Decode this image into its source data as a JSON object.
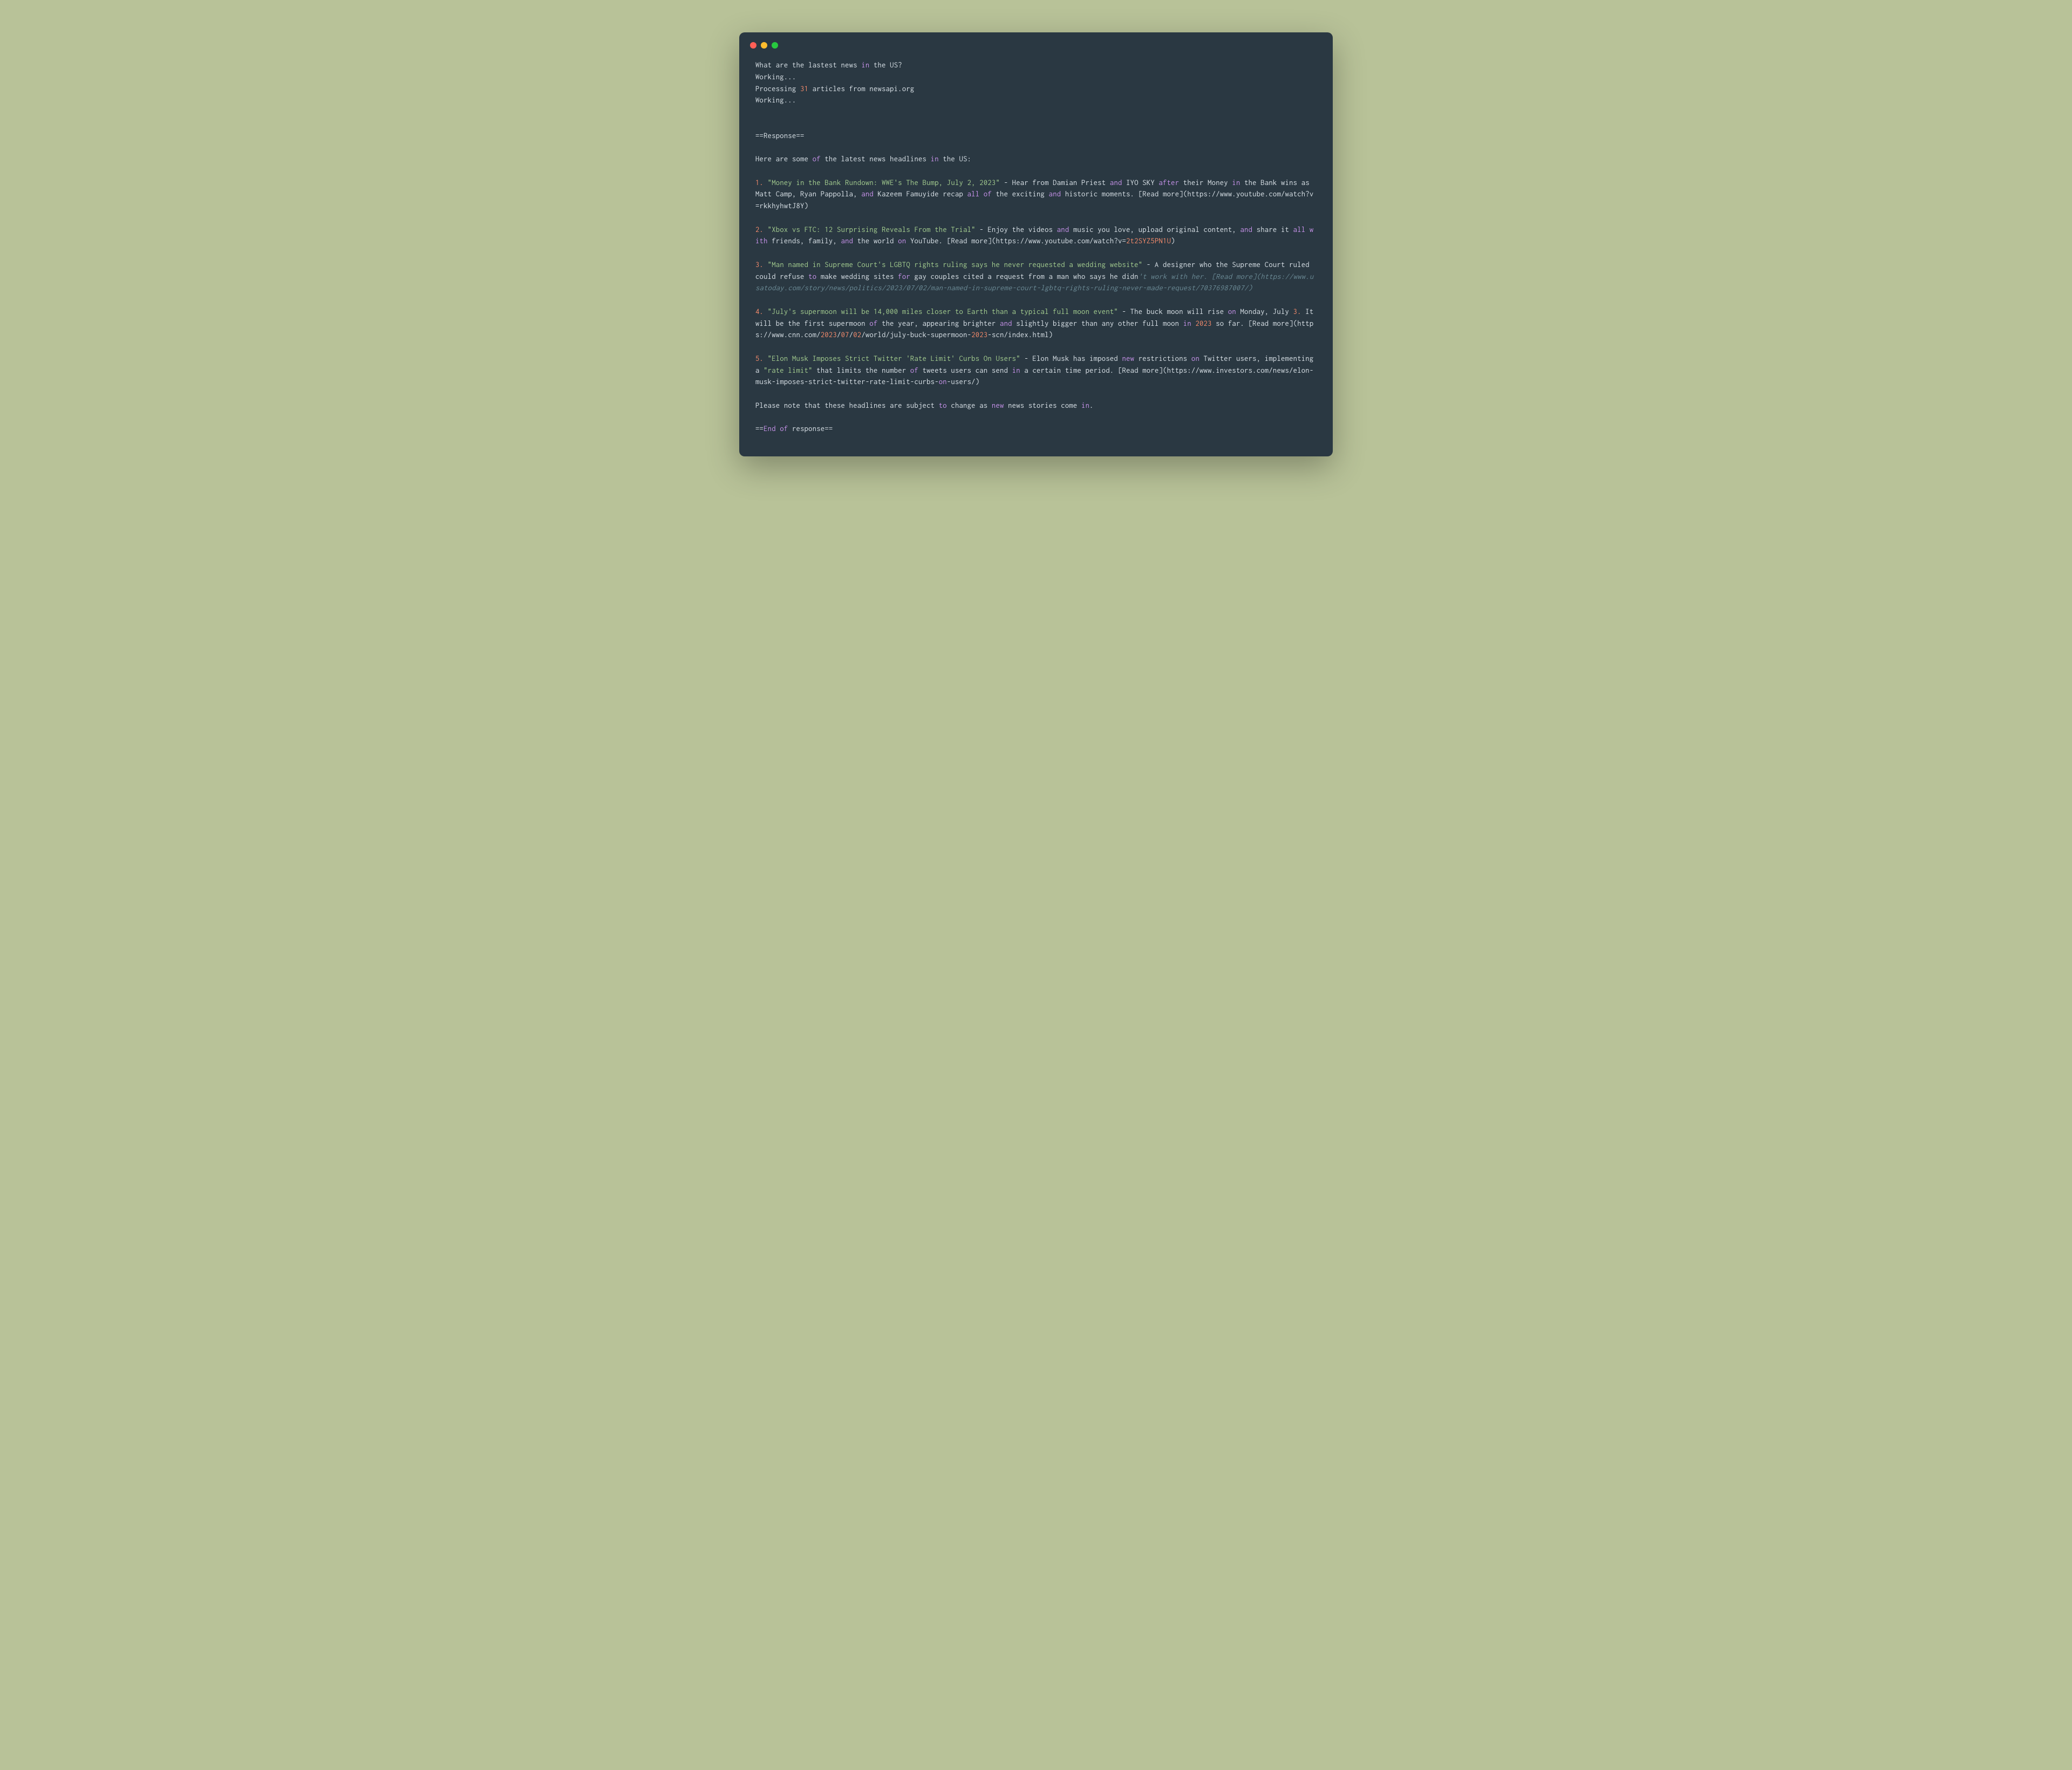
{
  "title_bar": {
    "buttons": [
      "close",
      "minimize",
      "maximize"
    ]
  },
  "lines": [
    [
      {
        "text": "What are the lastest news ",
        "cls": "default"
      },
      {
        "text": "in",
        "cls": "keyword"
      },
      {
        "text": " the US?",
        "cls": "default"
      }
    ],
    [
      {
        "text": "Working...",
        "cls": "default"
      }
    ],
    [
      {
        "text": "Processing ",
        "cls": "default"
      },
      {
        "text": "31",
        "cls": "number"
      },
      {
        "text": " articles from newsapi.org",
        "cls": "default"
      }
    ],
    [
      {
        "text": "Working...",
        "cls": "default"
      }
    ],
    [],
    [],
    [
      {
        "text": "==Response==",
        "cls": "default"
      }
    ],
    [],
    [
      {
        "text": "Here are some ",
        "cls": "default"
      },
      {
        "text": "of",
        "cls": "keyword"
      },
      {
        "text": " the latest news headlines ",
        "cls": "default"
      },
      {
        "text": "in",
        "cls": "keyword"
      },
      {
        "text": " the US:",
        "cls": "default"
      }
    ],
    [],
    [
      {
        "text": "1.",
        "cls": "number"
      },
      {
        "text": " ",
        "cls": "default"
      },
      {
        "text": "\"Money in the Bank Rundown: WWE's The Bump, July 2, 2023\"",
        "cls": "string"
      },
      {
        "text": " - Hear from Damian Priest ",
        "cls": "default"
      },
      {
        "text": "and",
        "cls": "keyword"
      },
      {
        "text": " IYO SKY ",
        "cls": "default"
      },
      {
        "text": "after",
        "cls": "keyword"
      },
      {
        "text": " their Money ",
        "cls": "default"
      },
      {
        "text": "in",
        "cls": "keyword"
      },
      {
        "text": " the Bank wins as Matt Camp, Ryan Pappolla, ",
        "cls": "default"
      },
      {
        "text": "and",
        "cls": "keyword"
      },
      {
        "text": " Kazeem Famuyide recap ",
        "cls": "default"
      },
      {
        "text": "all",
        "cls": "keyword"
      },
      {
        "text": " ",
        "cls": "default"
      },
      {
        "text": "of",
        "cls": "keyword"
      },
      {
        "text": " the exciting ",
        "cls": "default"
      },
      {
        "text": "and",
        "cls": "keyword"
      },
      {
        "text": " historic moments. [Read more](https://www.youtube.com/watch?v=rkkhyhwtJ8Y)",
        "cls": "default"
      }
    ],
    [],
    [
      {
        "text": "2.",
        "cls": "number"
      },
      {
        "text": " ",
        "cls": "default"
      },
      {
        "text": "\"Xbox vs FTC: 12 Surprising Reveals From the Trial\"",
        "cls": "string"
      },
      {
        "text": " - Enjoy the videos ",
        "cls": "default"
      },
      {
        "text": "and",
        "cls": "keyword"
      },
      {
        "text": " music you love, upload original content, ",
        "cls": "default"
      },
      {
        "text": "and",
        "cls": "keyword"
      },
      {
        "text": " share it ",
        "cls": "default"
      },
      {
        "text": "all",
        "cls": "keyword"
      },
      {
        "text": " ",
        "cls": "default"
      },
      {
        "text": "with",
        "cls": "keyword"
      },
      {
        "text": " friends, family, ",
        "cls": "default"
      },
      {
        "text": "and",
        "cls": "keyword"
      },
      {
        "text": " the world ",
        "cls": "default"
      },
      {
        "text": "on",
        "cls": "keyword"
      },
      {
        "text": " YouTube. [Read more](https://www.youtube.com/watch?v=",
        "cls": "default"
      },
      {
        "text": "2t2SYZ5PN1U",
        "cls": "number"
      },
      {
        "text": ")",
        "cls": "default"
      }
    ],
    [],
    [
      {
        "text": "3.",
        "cls": "number"
      },
      {
        "text": " ",
        "cls": "default"
      },
      {
        "text": "\"Man named in Supreme Court's LGBTQ rights ruling says he never requested a wedding website\"",
        "cls": "string"
      },
      {
        "text": " - A designer who the Supreme Court ruled could refuse ",
        "cls": "default"
      },
      {
        "text": "to",
        "cls": "keyword"
      },
      {
        "text": " make wedding sites ",
        "cls": "default"
      },
      {
        "text": "for",
        "cls": "keyword"
      },
      {
        "text": " gay couples cited a request from a man who says he didn",
        "cls": "default"
      },
      {
        "text": "'t work with her. [Read more](https://www.usatoday.com/story/news/politics/2023/07/02/man-named-in-supreme-court-lgbtq-rights-ruling-never-made-request/70376987007/)",
        "cls": "comment"
      }
    ],
    [],
    [
      {
        "text": "4.",
        "cls": "number"
      },
      {
        "text": " ",
        "cls": "default"
      },
      {
        "text": "\"July's supermoon will be 14,000 miles closer to Earth than a typical full moon event\"",
        "cls": "string"
      },
      {
        "text": " - The buck moon will rise ",
        "cls": "default"
      },
      {
        "text": "on",
        "cls": "keyword"
      },
      {
        "text": " Monday, July ",
        "cls": "default"
      },
      {
        "text": "3.",
        "cls": "number"
      },
      {
        "text": " It will be the first supermoon ",
        "cls": "default"
      },
      {
        "text": "of",
        "cls": "keyword"
      },
      {
        "text": " the year, appearing brighter ",
        "cls": "default"
      },
      {
        "text": "and",
        "cls": "keyword"
      },
      {
        "text": " slightly bigger than any other full moon ",
        "cls": "default"
      },
      {
        "text": "in",
        "cls": "keyword"
      },
      {
        "text": " ",
        "cls": "default"
      },
      {
        "text": "2023",
        "cls": "number"
      },
      {
        "text": " so far. [Read more](https://www.cnn.com/",
        "cls": "default"
      },
      {
        "text": "2023",
        "cls": "number"
      },
      {
        "text": "/",
        "cls": "default"
      },
      {
        "text": "07",
        "cls": "number"
      },
      {
        "text": "/",
        "cls": "default"
      },
      {
        "text": "02",
        "cls": "number"
      },
      {
        "text": "/world/july-buck-supermoon-",
        "cls": "default"
      },
      {
        "text": "2023",
        "cls": "number"
      },
      {
        "text": "-scn/index.html)",
        "cls": "default"
      }
    ],
    [],
    [
      {
        "text": "5.",
        "cls": "number"
      },
      {
        "text": " ",
        "cls": "default"
      },
      {
        "text": "\"Elon Musk Imposes Strict Twitter 'Rate Limit' Curbs On Users\"",
        "cls": "string"
      },
      {
        "text": " - Elon Musk has imposed ",
        "cls": "default"
      },
      {
        "text": "new",
        "cls": "keyword"
      },
      {
        "text": " restrictions ",
        "cls": "default"
      },
      {
        "text": "on",
        "cls": "keyword"
      },
      {
        "text": " Twitter users, implementing a ",
        "cls": "default"
      },
      {
        "text": "\"rate limit\"",
        "cls": "string"
      },
      {
        "text": " that limits the number ",
        "cls": "default"
      },
      {
        "text": "of",
        "cls": "keyword"
      },
      {
        "text": " tweets users can send ",
        "cls": "default"
      },
      {
        "text": "in",
        "cls": "keyword"
      },
      {
        "text": " a certain time period. [Read more](https://www.investors.com/news/elon-musk-imposes-strict-twitter-rate-limit-curbs-",
        "cls": "default"
      },
      {
        "text": "on",
        "cls": "keyword"
      },
      {
        "text": "-users/)",
        "cls": "default"
      }
    ],
    [],
    [
      {
        "text": "Please note that these headlines are subject ",
        "cls": "default"
      },
      {
        "text": "to",
        "cls": "keyword"
      },
      {
        "text": " change as ",
        "cls": "default"
      },
      {
        "text": "new",
        "cls": "keyword"
      },
      {
        "text": " news stories come ",
        "cls": "default"
      },
      {
        "text": "in",
        "cls": "keyword"
      },
      {
        "text": ".",
        "cls": "default"
      }
    ],
    [],
    [
      {
        "text": "==",
        "cls": "default"
      },
      {
        "text": "End",
        "cls": "keyword"
      },
      {
        "text": " ",
        "cls": "default"
      },
      {
        "text": "of",
        "cls": "keyword"
      },
      {
        "text": " response==",
        "cls": "default"
      }
    ]
  ]
}
